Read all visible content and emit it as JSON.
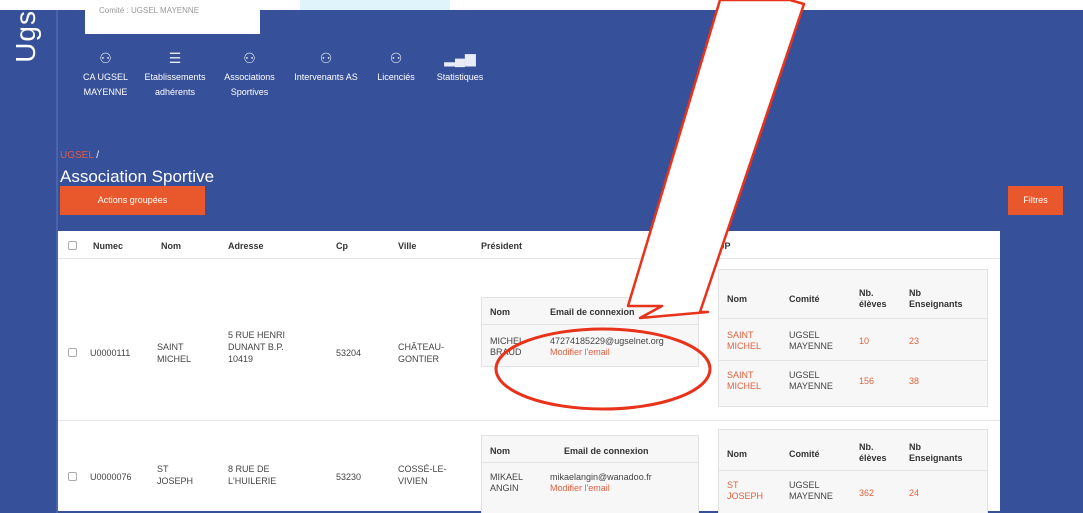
{
  "brand": "Ugs",
  "breadcrumb_top": "Comité : UGSEL MAYENNE",
  "nav": [
    {
      "icon": "group-icon",
      "glyph": "👥",
      "label1": "CA UGSEL",
      "label2": "MAYENNE"
    },
    {
      "icon": "list-icon",
      "glyph": "☰",
      "label1": "Etablissements",
      "label2": "adhérents"
    },
    {
      "icon": "group-icon",
      "glyph": "👥",
      "label1": "Associations",
      "label2": "Sportives"
    },
    {
      "icon": "people-icon",
      "glyph": "👥",
      "label1": "Intervenants AS",
      "label2": ""
    },
    {
      "icon": "group-icon",
      "glyph": "👥",
      "label1": "Licenciés",
      "label2": ""
    },
    {
      "icon": "bar-chart-icon",
      "glyph": "▁▃▅",
      "label1": "Statistiques",
      "label2": ""
    }
  ],
  "crumb": {
    "link": "UGSEL",
    "sep": " /"
  },
  "title": "Association Sportive",
  "buttons": {
    "actions": "Actions groupées",
    "filtres": "Filtres"
  },
  "headers": {
    "numec": "Numec",
    "nom": "Nom",
    "adresse": "Adresse",
    "cp": "Cp",
    "ville": "Ville",
    "president": "Président",
    "up": "UP"
  },
  "sub_headers": {
    "nom": "Nom",
    "email": "Email de connexion",
    "comite": "Comité",
    "nb_eleves1": "Nb.",
    "nb_eleves2": "élèves",
    "nb_ens1": "Nb",
    "nb_ens2": "Enseignants"
  },
  "rows": [
    {
      "numec": "U0000111",
      "nom1": "SAINT",
      "nom2": "MICHEL",
      "adresse1": "5 RUE HENRI",
      "adresse2": "DUNANT B.P.",
      "adresse3": "10419",
      "cp": "53204",
      "ville1": "CHÂTEAU-",
      "ville2": "GONTIER",
      "pres_nom1": "MICHEL",
      "pres_nom2": "BRAUD",
      "pres_email": "47274185229@ugselnet.org",
      "modify": "Modifier l'email",
      "up": [
        {
          "nom1": "SAINT",
          "nom2": "MICHEL",
          "comite1": "UGSEL",
          "comite2": "MAYENNE",
          "eleves": "10",
          "ens": "23"
        },
        {
          "nom1": "SAINT",
          "nom2": "MICHEL",
          "comite1": "UGSEL",
          "comite2": "MAYENNE",
          "eleves": "156",
          "ens": "38"
        }
      ]
    },
    {
      "numec": "U0000076",
      "nom1": "ST",
      "nom2": "JOSEPH",
      "adresse1": "8 RUE DE",
      "adresse2": "L'HUILERIE",
      "cp": "53230",
      "ville1": "COSSÉ-LE-",
      "ville2": "VIVIEN",
      "pres_nom1": "MIKAEL",
      "pres_nom2": "ANGIN",
      "pres_email": "mikaelangin@wanadoo.fr",
      "modify": "Modifier l'email",
      "up": [
        {
          "nom1": "ST",
          "nom2": "JOSEPH",
          "comite1": "UGSEL",
          "comite2": "MAYENNE",
          "eleves": "362",
          "ens": "24"
        }
      ]
    }
  ],
  "colors": {
    "navy": "#36509a",
    "orange": "#e8582c",
    "annotation": "#e8321a"
  }
}
